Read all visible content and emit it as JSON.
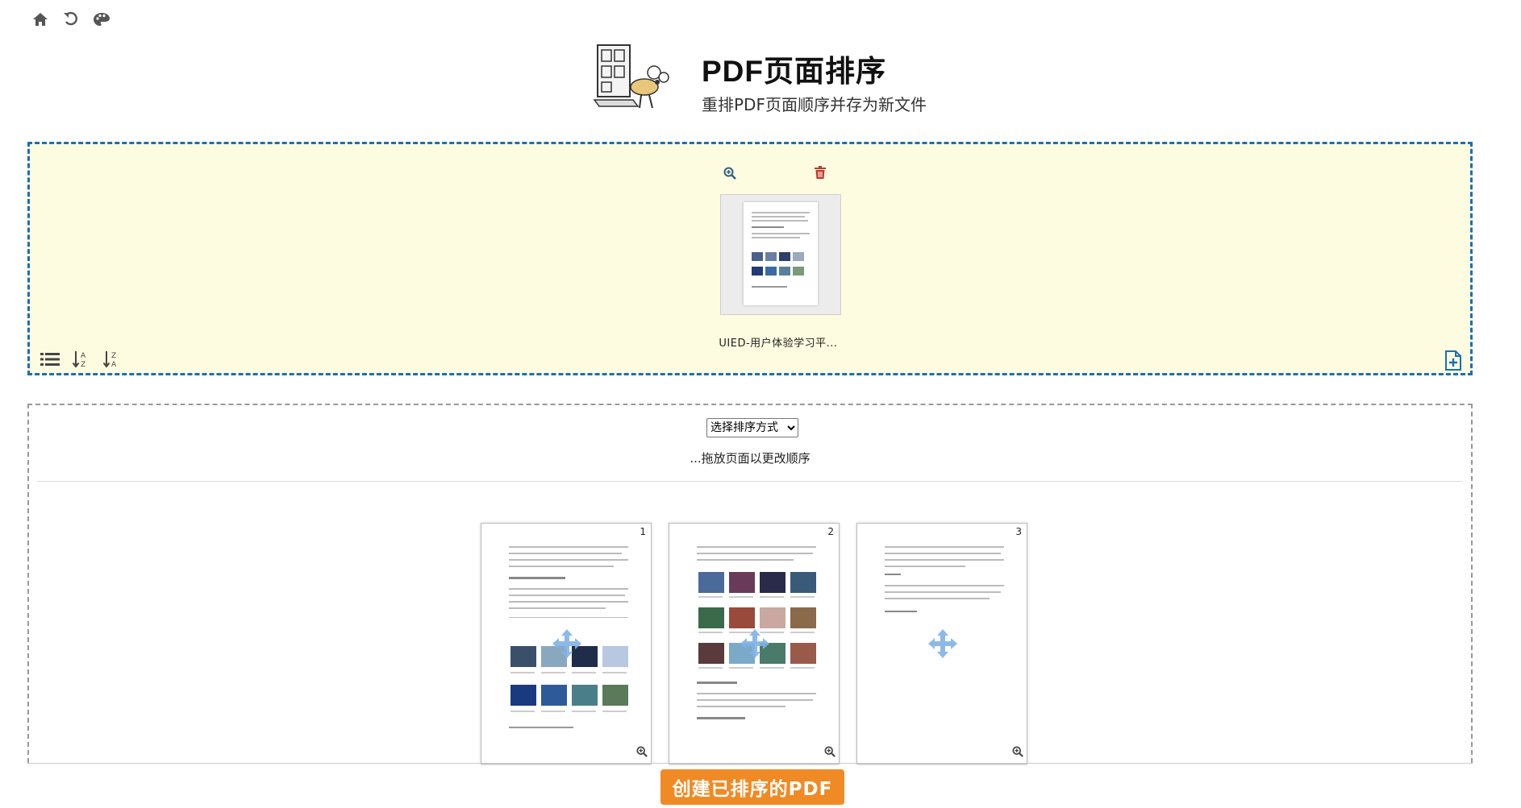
{
  "app": {
    "title": "PDF页面排序",
    "subtitle": "重排PDF页面顺序并存为新文件"
  },
  "toolbar": {
    "icons": [
      "home-icon",
      "undo-icon",
      "palette-icon"
    ]
  },
  "dropzone": {
    "file": {
      "name": "UIED-用户体验学习平..."
    },
    "tools": [
      "list-icon",
      "sort-az-icon",
      "sort-za-icon"
    ],
    "add_icon": "file-plus-icon",
    "colors": {
      "background": "#fdfce0",
      "border": "#1c6fb0",
      "trash": "#c0392b"
    }
  },
  "sort": {
    "select_value": "选择排序方式",
    "hint": "...拖放页面以更改顺序",
    "pages": [
      {
        "num": "1"
      },
      {
        "num": "2"
      },
      {
        "num": "3"
      }
    ]
  },
  "actions": {
    "create_label": "创建已排序的PDF",
    "accent": "#f08a24"
  }
}
